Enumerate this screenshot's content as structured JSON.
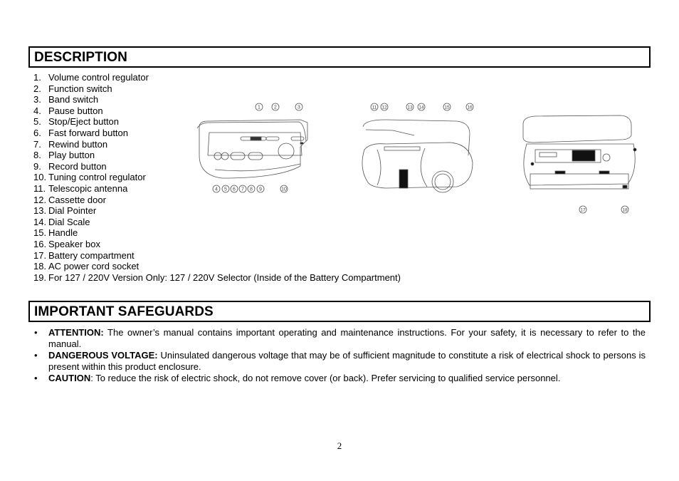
{
  "description": {
    "heading": "DESCRIPTION",
    "items": [
      {
        "num": "1.",
        "label": "Volume control regulator"
      },
      {
        "num": "2.",
        "label": "Function switch"
      },
      {
        "num": "3.",
        "label": "Band switch"
      },
      {
        "num": "4.",
        "label": "Pause button"
      },
      {
        "num": "5.",
        "label": "Stop/Eject button"
      },
      {
        "num": "6.",
        "label": "Fast forward button"
      },
      {
        "num": "7.",
        "label": "Rewind button"
      },
      {
        "num": "8.",
        "label": "Play button"
      },
      {
        "num": "9.",
        "label": "Record button"
      },
      {
        "num": "10.",
        "label": "Tuning control regulator"
      },
      {
        "num": "11.",
        "label": "Telescopic antenna"
      },
      {
        "num": "12.",
        "label": "Cassette door"
      },
      {
        "num": "13.",
        "label": "Dial Pointer"
      },
      {
        "num": "14.",
        "label": "Dial Scale"
      },
      {
        "num": "15.",
        "label": "Handle"
      },
      {
        "num": "16.",
        "label": "Speaker box"
      },
      {
        "num": "17.",
        "label": "Battery compartment"
      },
      {
        "num": "18.",
        "label": "AC power cord socket"
      },
      {
        "num": "19.",
        "label": "For 127 / 220V Version Only: 127 / 220V Selector (Inside of the Battery Compartment)"
      }
    ],
    "figure_callouts": {
      "top_view": [
        "1",
        "2",
        "3",
        "4",
        "5",
        "6",
        "7",
        "8",
        "9",
        "10"
      ],
      "front_view": [
        "11",
        "12",
        "13",
        "14",
        "15",
        "16"
      ],
      "back_view": [
        "17",
        "18"
      ]
    }
  },
  "safeguards": {
    "heading": "IMPORTANT SAFEGUARDS",
    "bullet": "•",
    "items": [
      {
        "label": "ATTENTION:",
        "text": " The owner’s manual contains important operating and maintenance instructions. For your safety, it is necessary to refer to the manual."
      },
      {
        "label": "DANGEROUS VOLTAGE:",
        "text": " Uninsulated dangerous voltage that may be of sufficient magnitude to constitute a risk of electrical shock to persons is present within this product enclosure."
      },
      {
        "label": "CAUTION",
        "text": ":  To reduce the risk of electric shock, do not remove cover (or back). Prefer servicing to qualified service personnel."
      }
    ]
  },
  "page_number": "2"
}
